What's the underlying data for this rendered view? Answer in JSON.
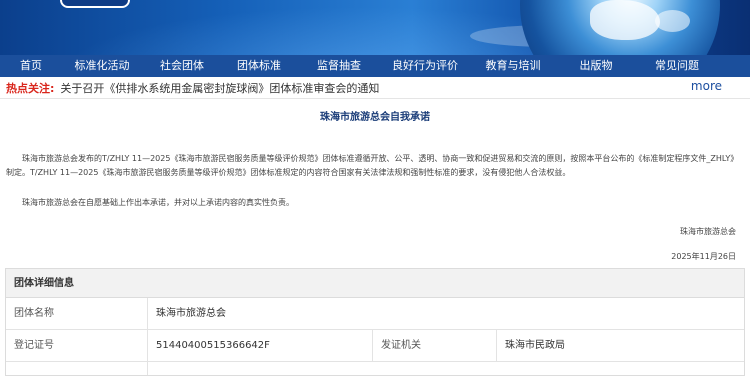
{
  "nav": {
    "items": [
      "首页",
      "标准化活动",
      "社会团体",
      "团体标准",
      "监督抽查",
      "良好行为评价",
      "教育与培训",
      "出版物",
      "常见问题"
    ]
  },
  "notice": {
    "hot_label": "热点关注:",
    "headline": "关于召开《供排水系统用金属密封旋球阀》团体标准审查会的通知",
    "more": "more"
  },
  "commitment": {
    "title": "珠海市旅游总会自我承诺",
    "paragraph1": "珠海市旅游总会发布的T/ZHLY 11—2025《珠海市旅游民宿服务质量等级评价规范》团体标准遵循开放、公平、透明、协商一致和促进贸易和交流的原则，按照本平台公布的《标准制定程序文件_ZHLY》制定。T/ZHLY 11—2025《珠海市旅游民宿服务质量等级评价规范》团体标准规定的内容符合国家有关法律法规和强制性标准的要求，没有侵犯他人合法权益。",
    "paragraph2": "珠海市旅游总会在自愿基础上作出本承诺，并对以上承诺内容的真实性负责。",
    "signature": "珠海市旅游总会",
    "date": "2025年11月26日"
  },
  "detail": {
    "heading": "团体详细信息",
    "name_label": "团体名称",
    "name_value": "珠海市旅游总会",
    "reg_label": "登记证号",
    "reg_value": "51440400515366642F",
    "issuer_label": "发证机关",
    "issuer_value": "珠海市民政局"
  },
  "colors": {
    "nav_bg": "#1b4f9c",
    "hot": "#d9261c",
    "title": "#1a3c78"
  }
}
